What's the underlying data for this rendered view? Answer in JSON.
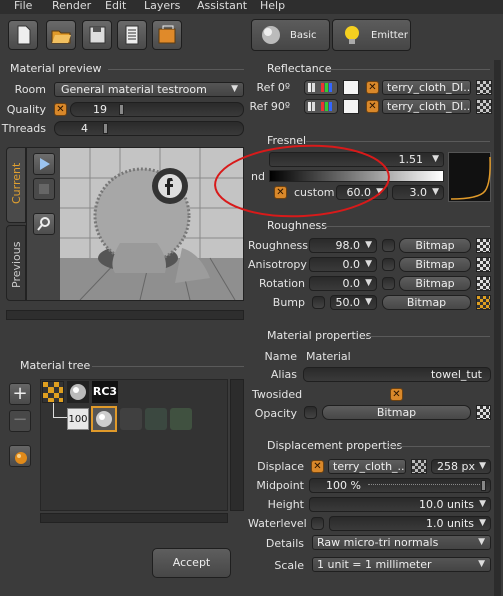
{
  "menu": [
    "File",
    "Render",
    "Edit",
    "Layers",
    "Assistant",
    "Help"
  ],
  "mode_buttons": {
    "basic": "Basic",
    "emitter": "Emitter"
  },
  "preview": {
    "title": "Material preview",
    "room_label": "Room",
    "room_value": "General material testroom",
    "quality_label": "Quality",
    "quality_value": "19",
    "threads_label": "Threads",
    "threads_value": "4",
    "tab_current": "Current",
    "tab_previous": "Previous"
  },
  "tree": {
    "title": "Material tree",
    "node_value": "100",
    "rc_label": "RC3"
  },
  "accept": "Accept",
  "reflectance": {
    "title": "Reflectance",
    "ref0_label": "Ref 0º",
    "ref0_texture": "terry_cloth_DI...",
    "ref90_label": "Ref 90º",
    "ref90_texture": "terry_cloth_DI..."
  },
  "fresnel": {
    "title": "Fresnel",
    "ior_value": "1.51",
    "nd_label": "nd",
    "custom_label": "custom",
    "custom_a": "60.0",
    "custom_b": "3.0"
  },
  "roughness": {
    "title": "Roughness",
    "rows": [
      {
        "label": "Roughness",
        "value": "98.0",
        "btn": "Bitmap"
      },
      {
        "label": "Anisotropy",
        "value": "0.0",
        "btn": "Bitmap"
      },
      {
        "label": "Rotation",
        "value": "0.0",
        "btn": "Bitmap"
      },
      {
        "label": "Bump",
        "value": "50.0",
        "btn": "Bitmap"
      }
    ]
  },
  "material_props": {
    "title": "Material properties",
    "name_label": "Name",
    "name_value": "Material",
    "alias_label": "Alias",
    "alias_value": "towel_tut",
    "twosided_label": "Twosided",
    "opacity_label": "Opacity",
    "opacity_btn": "Bitmap"
  },
  "displacement": {
    "title": "Displacement properties",
    "displace_label": "Displace",
    "displace_texture": "terry_cloth_...",
    "displace_px": "258 px",
    "midpoint_label": "Midpoint",
    "midpoint_value": "100  %",
    "height_label": "Height",
    "height_value": "10.0 units",
    "waterlevel_label": "Waterlevel",
    "waterlevel_value": "1.0 units",
    "details_label": "Details",
    "details_value": "Raw micro-tri normals",
    "scale_label": "Scale",
    "scale_value": "1 unit = 1 millimeter"
  },
  "colors": {
    "accent": "#d9882a",
    "annotation": "#d81a1a"
  }
}
